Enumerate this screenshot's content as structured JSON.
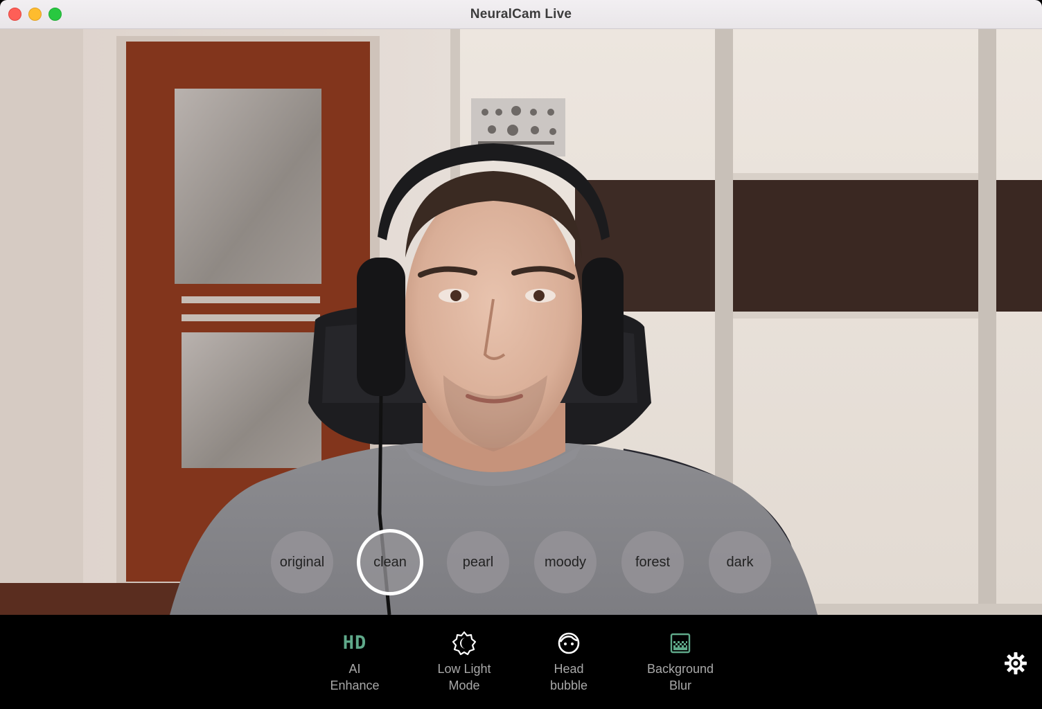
{
  "window": {
    "title": "NeuralCam Live"
  },
  "filters": [
    {
      "label": "original",
      "selected": false
    },
    {
      "label": "clean",
      "selected": true
    },
    {
      "label": "pearl",
      "selected": false
    },
    {
      "label": "moody",
      "selected": false
    },
    {
      "label": "forest",
      "selected": false
    },
    {
      "label": "dark",
      "selected": false
    }
  ],
  "toolbar": {
    "ai_enhance": {
      "icon": "HD",
      "line1": "AI",
      "line2": "Enhance"
    },
    "low_light": {
      "icon": "low-light-icon",
      "line1": "Low Light",
      "line2": "Mode"
    },
    "head_bubble": {
      "icon": "face-icon",
      "line1": "Head",
      "line2": "bubble"
    },
    "background_blur": {
      "icon": "blur-icon",
      "line1": "Background",
      "line2": "Blur"
    },
    "settings_icon": "gear-icon"
  },
  "colors": {
    "accent_green": "#5fa98a",
    "toolbar_text": "#a9a9a9"
  }
}
